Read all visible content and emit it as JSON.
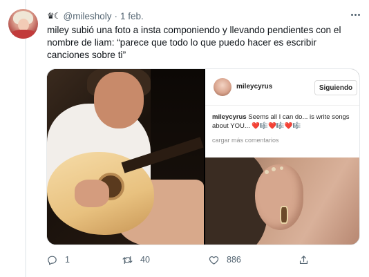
{
  "tweet": {
    "display_emoji": "♛☾",
    "handle": "@milesholy",
    "separator": "·",
    "date": "1 feb.",
    "text": "miley subió una foto a insta componiendo y llevando pendientes con el nombre de liam: “parece que todo lo que puedo hacer es escribir canciones sobre ti”"
  },
  "embed": {
    "username": "mileycyrus",
    "follow_label": "Siguiendo",
    "caption_user": "mileycyrus",
    "caption_text": "Seems all I can do... is write songs about YOU... ❤️🎼❤️🎼❤️🎼",
    "load_more": "cargar más comentarios"
  },
  "actions": {
    "reply_count": "1",
    "retweet_count": "40",
    "like_count": "886"
  },
  "icons": [
    "more-icon",
    "reply-icon",
    "retweet-icon",
    "like-icon",
    "share-icon"
  ],
  "colors": {
    "secondary_text": "#536471",
    "text": "#0f1419"
  }
}
